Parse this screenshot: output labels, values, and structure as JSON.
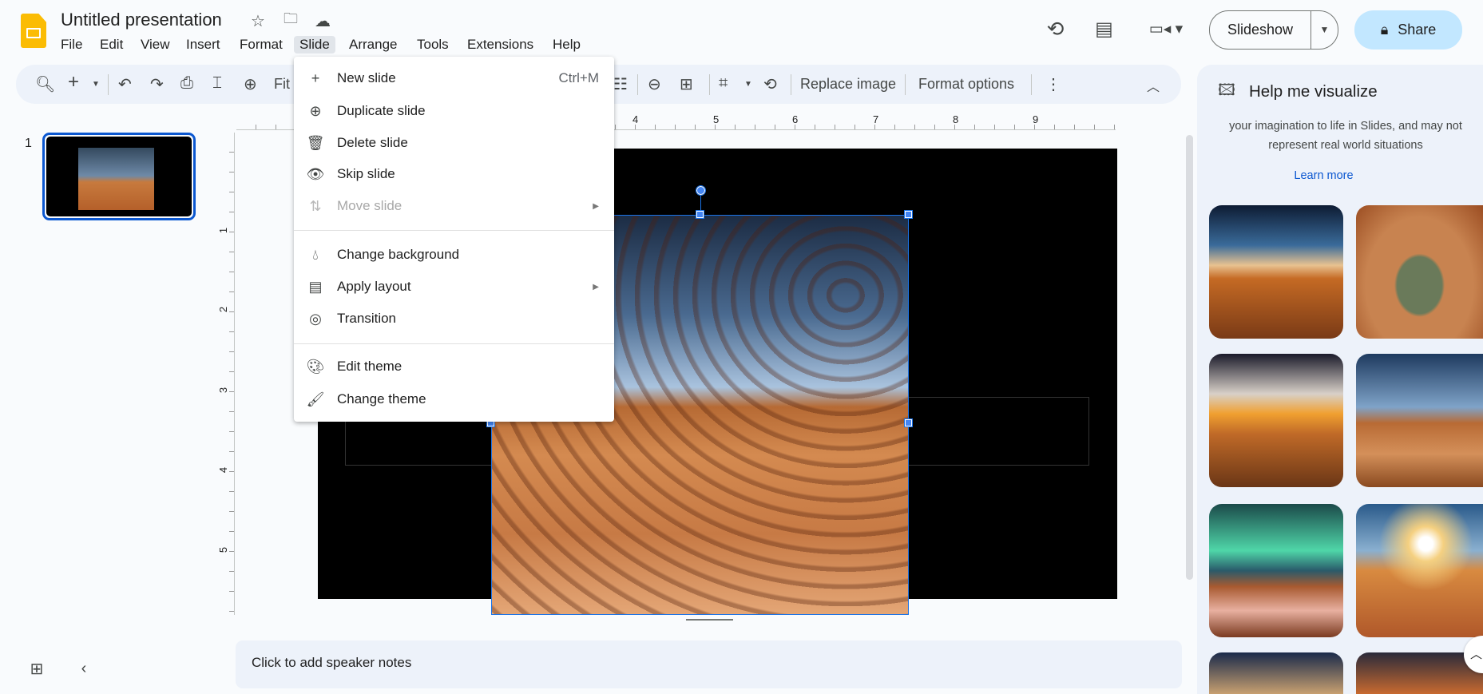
{
  "app": {
    "title": "Untitled presentation"
  },
  "menubar": [
    "File",
    "Edit",
    "View",
    "Insert",
    "Format",
    "Slide",
    "Arrange",
    "Tools",
    "Extensions",
    "Help"
  ],
  "header": {
    "slideshow_label": "Slideshow",
    "share_label": "Share"
  },
  "toolbar": {
    "zoom_label": "Fit",
    "replace_image": "Replace image",
    "format_options": "Format options"
  },
  "ruler": {
    "h_ticks": [
      "4",
      "5",
      "6",
      "7",
      "8",
      "9"
    ],
    "v_ticks": [
      "1",
      "2",
      "3",
      "4",
      "5"
    ]
  },
  "filmstrip": {
    "slides": [
      {
        "number": "1"
      }
    ]
  },
  "slide_menu": {
    "items": [
      {
        "label": "New slide",
        "shortcut": "Ctrl+M",
        "icon": "plus"
      },
      {
        "label": "Duplicate slide",
        "icon": "duplicate"
      },
      {
        "label": "Delete slide",
        "icon": "trash"
      },
      {
        "label": "Skip slide",
        "icon": "eye"
      },
      {
        "label": "Move slide",
        "icon": "move",
        "disabled": true,
        "submenu": true
      },
      {
        "label": "Change background",
        "icon": "drop"
      },
      {
        "label": "Apply layout",
        "icon": "layout",
        "submenu": true
      },
      {
        "label": "Transition",
        "icon": "transition"
      },
      {
        "label": "Edit theme",
        "icon": "palette"
      },
      {
        "label": "Change theme",
        "icon": "paint-roller"
      }
    ]
  },
  "notes": {
    "placeholder": "Click to add speaker notes"
  },
  "side_panel": {
    "title": "Help me visualize",
    "description": "your imagination to life in Slides, and may not represent real world situations",
    "learn_more": "Learn more"
  },
  "colors": {
    "accent": "#1a73e8",
    "share_bg": "#c2e7ff",
    "panel_bg": "#edf2fa"
  }
}
